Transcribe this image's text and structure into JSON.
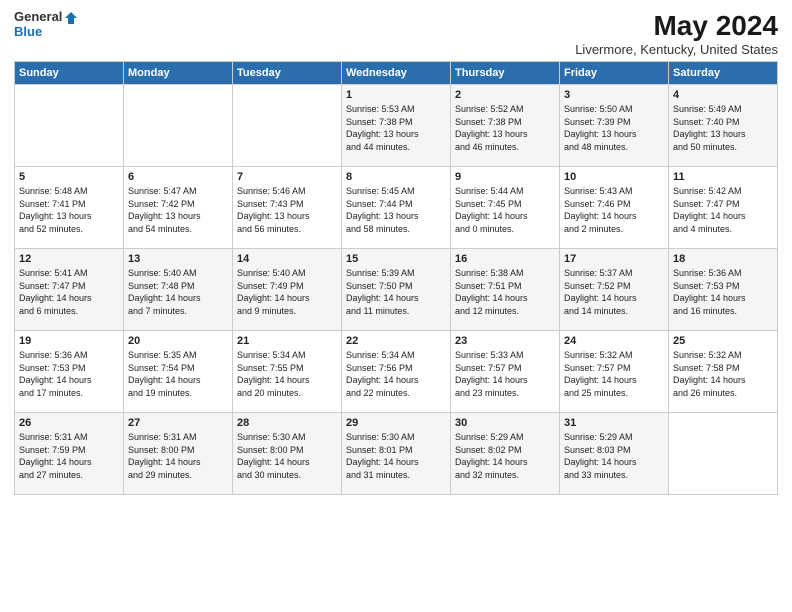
{
  "app": {
    "logo_general": "General",
    "logo_blue": "Blue",
    "title": "May 2024",
    "subtitle": "Livermore, Kentucky, United States"
  },
  "calendar": {
    "headers": [
      "Sunday",
      "Monday",
      "Tuesday",
      "Wednesday",
      "Thursday",
      "Friday",
      "Saturday"
    ],
    "weeks": [
      [
        {
          "day": "",
          "info": ""
        },
        {
          "day": "",
          "info": ""
        },
        {
          "day": "",
          "info": ""
        },
        {
          "day": "1",
          "info": "Sunrise: 5:53 AM\nSunset: 7:38 PM\nDaylight: 13 hours\nand 44 minutes."
        },
        {
          "day": "2",
          "info": "Sunrise: 5:52 AM\nSunset: 7:38 PM\nDaylight: 13 hours\nand 46 minutes."
        },
        {
          "day": "3",
          "info": "Sunrise: 5:50 AM\nSunset: 7:39 PM\nDaylight: 13 hours\nand 48 minutes."
        },
        {
          "day": "4",
          "info": "Sunrise: 5:49 AM\nSunset: 7:40 PM\nDaylight: 13 hours\nand 50 minutes."
        }
      ],
      [
        {
          "day": "5",
          "info": "Sunrise: 5:48 AM\nSunset: 7:41 PM\nDaylight: 13 hours\nand 52 minutes."
        },
        {
          "day": "6",
          "info": "Sunrise: 5:47 AM\nSunset: 7:42 PM\nDaylight: 13 hours\nand 54 minutes."
        },
        {
          "day": "7",
          "info": "Sunrise: 5:46 AM\nSunset: 7:43 PM\nDaylight: 13 hours\nand 56 minutes."
        },
        {
          "day": "8",
          "info": "Sunrise: 5:45 AM\nSunset: 7:44 PM\nDaylight: 13 hours\nand 58 minutes."
        },
        {
          "day": "9",
          "info": "Sunrise: 5:44 AM\nSunset: 7:45 PM\nDaylight: 14 hours\nand 0 minutes."
        },
        {
          "day": "10",
          "info": "Sunrise: 5:43 AM\nSunset: 7:46 PM\nDaylight: 14 hours\nand 2 minutes."
        },
        {
          "day": "11",
          "info": "Sunrise: 5:42 AM\nSunset: 7:47 PM\nDaylight: 14 hours\nand 4 minutes."
        }
      ],
      [
        {
          "day": "12",
          "info": "Sunrise: 5:41 AM\nSunset: 7:47 PM\nDaylight: 14 hours\nand 6 minutes."
        },
        {
          "day": "13",
          "info": "Sunrise: 5:40 AM\nSunset: 7:48 PM\nDaylight: 14 hours\nand 7 minutes."
        },
        {
          "day": "14",
          "info": "Sunrise: 5:40 AM\nSunset: 7:49 PM\nDaylight: 14 hours\nand 9 minutes."
        },
        {
          "day": "15",
          "info": "Sunrise: 5:39 AM\nSunset: 7:50 PM\nDaylight: 14 hours\nand 11 minutes."
        },
        {
          "day": "16",
          "info": "Sunrise: 5:38 AM\nSunset: 7:51 PM\nDaylight: 14 hours\nand 12 minutes."
        },
        {
          "day": "17",
          "info": "Sunrise: 5:37 AM\nSunset: 7:52 PM\nDaylight: 14 hours\nand 14 minutes."
        },
        {
          "day": "18",
          "info": "Sunrise: 5:36 AM\nSunset: 7:53 PM\nDaylight: 14 hours\nand 16 minutes."
        }
      ],
      [
        {
          "day": "19",
          "info": "Sunrise: 5:36 AM\nSunset: 7:53 PM\nDaylight: 14 hours\nand 17 minutes."
        },
        {
          "day": "20",
          "info": "Sunrise: 5:35 AM\nSunset: 7:54 PM\nDaylight: 14 hours\nand 19 minutes."
        },
        {
          "day": "21",
          "info": "Sunrise: 5:34 AM\nSunset: 7:55 PM\nDaylight: 14 hours\nand 20 minutes."
        },
        {
          "day": "22",
          "info": "Sunrise: 5:34 AM\nSunset: 7:56 PM\nDaylight: 14 hours\nand 22 minutes."
        },
        {
          "day": "23",
          "info": "Sunrise: 5:33 AM\nSunset: 7:57 PM\nDaylight: 14 hours\nand 23 minutes."
        },
        {
          "day": "24",
          "info": "Sunrise: 5:32 AM\nSunset: 7:57 PM\nDaylight: 14 hours\nand 25 minutes."
        },
        {
          "day": "25",
          "info": "Sunrise: 5:32 AM\nSunset: 7:58 PM\nDaylight: 14 hours\nand 26 minutes."
        }
      ],
      [
        {
          "day": "26",
          "info": "Sunrise: 5:31 AM\nSunset: 7:59 PM\nDaylight: 14 hours\nand 27 minutes."
        },
        {
          "day": "27",
          "info": "Sunrise: 5:31 AM\nSunset: 8:00 PM\nDaylight: 14 hours\nand 29 minutes."
        },
        {
          "day": "28",
          "info": "Sunrise: 5:30 AM\nSunset: 8:00 PM\nDaylight: 14 hours\nand 30 minutes."
        },
        {
          "day": "29",
          "info": "Sunrise: 5:30 AM\nSunset: 8:01 PM\nDaylight: 14 hours\nand 31 minutes."
        },
        {
          "day": "30",
          "info": "Sunrise: 5:29 AM\nSunset: 8:02 PM\nDaylight: 14 hours\nand 32 minutes."
        },
        {
          "day": "31",
          "info": "Sunrise: 5:29 AM\nSunset: 8:03 PM\nDaylight: 14 hours\nand 33 minutes."
        },
        {
          "day": "",
          "info": ""
        }
      ]
    ]
  }
}
